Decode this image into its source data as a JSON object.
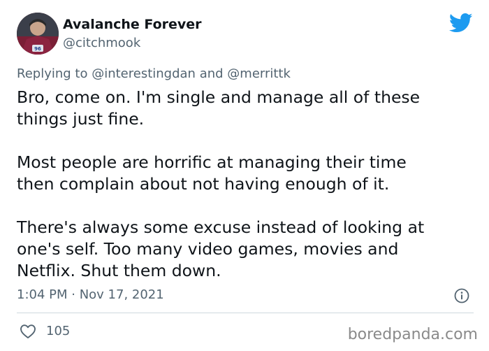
{
  "author": {
    "display_name": "Avalanche Forever",
    "handle": "@citchmook",
    "avatar_icon": "hockey-player-avatar",
    "jersey_number": "96"
  },
  "reply": {
    "prefix": "Replying to ",
    "mention_1": "@interestingdan",
    "joiner": " and ",
    "mention_2": "@merrittk"
  },
  "tweet": {
    "lines": [
      "Bro, come on. I'm single and manage all of these",
      "things just fine.",
      "Most people are horrific at managing their time",
      "then complain about not having enough of it.",
      "There's always some excuse instead of looking at",
      "one's self. Too many video games, movies and",
      "Netflix. Shut them down."
    ]
  },
  "meta": {
    "timestamp": "1:04 PM · Nov 17, 2021",
    "like_count": "105"
  },
  "icons": {
    "brand": "twitter-bird-icon",
    "info": "info-icon",
    "like": "heart-icon"
  },
  "watermark": "boredpanda.com",
  "colors": {
    "twitter_blue": "#1d9bf0",
    "secondary_text": "#536471",
    "primary_text": "#0f1419",
    "divider": "#cfd9de"
  }
}
